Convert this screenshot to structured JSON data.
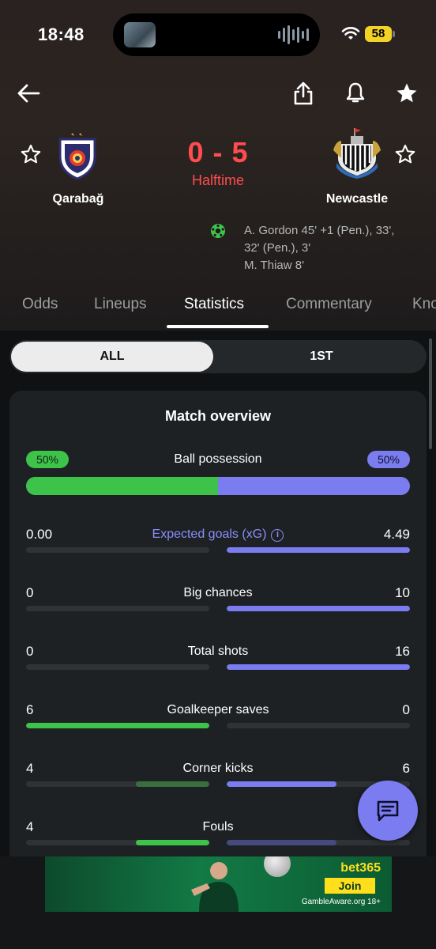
{
  "status_bar": {
    "time": "18:48",
    "battery": "58"
  },
  "match": {
    "home_team": "Qarabağ",
    "away_team": "Newcastle",
    "score": "0 - 5",
    "status": "Halftime",
    "scorers": [
      "A. Gordon 45' +1 (Pen.), 33',",
      "32' (Pen.), 3'",
      "M. Thiaw 8'"
    ]
  },
  "tabs": [
    "Odds",
    "Lineups",
    "Statistics",
    "Commentary",
    "Knockout"
  ],
  "active_tab": "Statistics",
  "period_toggle": {
    "all": "ALL",
    "first": "1ST"
  },
  "overview": {
    "title": "Match overview",
    "possession": {
      "label": "Ball possession",
      "home": "50%",
      "away": "50%",
      "home_fraction": 0.5
    },
    "stats": [
      {
        "label": "Expected goals (xG)",
        "home": "0.00",
        "away": "4.49",
        "home_share": 0.0,
        "away_share": 1.0,
        "accent": true,
        "winner": "away"
      },
      {
        "label": "Big chances",
        "home": "0",
        "away": "10",
        "home_share": 0.0,
        "away_share": 1.0,
        "winner": "away"
      },
      {
        "label": "Total shots",
        "home": "0",
        "away": "16",
        "home_share": 0.0,
        "away_share": 1.0,
        "winner": "away"
      },
      {
        "label": "Goalkeeper saves",
        "home": "6",
        "away": "0",
        "home_share": 1.0,
        "away_share": 0.0,
        "winner": "home"
      },
      {
        "label": "Corner kicks",
        "home": "4",
        "away": "6",
        "home_share": 0.4,
        "away_share": 0.6,
        "winner": "away"
      },
      {
        "label": "Fouls",
        "home": "4",
        "away": "",
        "home_share": 0.4,
        "away_share": 0.6,
        "winner": "home"
      }
    ]
  },
  "ad": {
    "brand": "bet365",
    "cta": "Join",
    "footer": "GambleAware.org 18+",
    "shirt_text": "bet365"
  },
  "colors": {
    "home": "#3ec34a",
    "away": "#7a7cf0",
    "score": "#ff4d4f",
    "background": "#0f1113",
    "card": "#1d2124"
  }
}
